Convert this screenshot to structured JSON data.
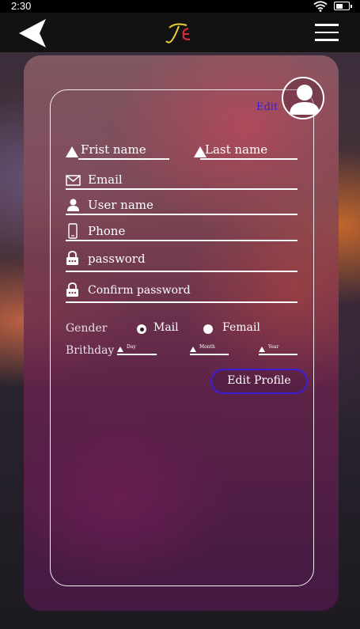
{
  "status_bar": {
    "time": "2:30"
  },
  "app_bar": {
    "logo_text": "TE"
  },
  "profile": {
    "edit_link": "Edit"
  },
  "form": {
    "first_name": "Frist name",
    "last_name": "Last name",
    "email": "Email",
    "username": "User name",
    "phone": "Phone",
    "password": "password",
    "confirm_password": "Confirm password",
    "gender_label": "Gender",
    "gender_options": [
      "Mail",
      "Femail"
    ],
    "gender_selected": "Mail",
    "birthday_label": "Brithday",
    "birthday_day": "Day",
    "birthday_month": "Month",
    "birthday_year": "Year"
  },
  "actions": {
    "edit_profile": "Edit Profile"
  },
  "colors": {
    "accent": "#3b1fd8",
    "app_bar": "#121212"
  }
}
